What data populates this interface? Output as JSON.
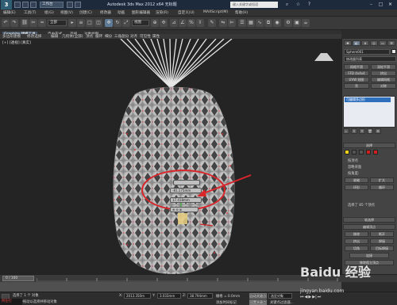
{
  "titlebar": {
    "logo": "3",
    "workspace": "工作台",
    "title": "Autodesk 3ds Max 2012 x64    无标题",
    "search_placeholder": "键入关键字或短语"
  },
  "menu": [
    "编辑(E)",
    "工具(T)",
    "组(G)",
    "视图(V)",
    "创建(C)",
    "修改器",
    "动画",
    "图形编辑器",
    "渲染(R)",
    "自定义(U)",
    "MAXScript(M)",
    "帮助(H)"
  ],
  "toolbar": {
    "filter_select": "全部",
    "view_select": "视图"
  },
  "ribbon": {
    "tabs": [
      "Graphite 建模工具",
      "自由形式",
      "选择",
      "对象绘制"
    ],
    "sub": [
      "多边形建模",
      "修改选择",
      "编辑",
      "几何体(全部)",
      "顶点",
      "循环",
      "细分",
      "三角剖分",
      "对齐",
      "可见性",
      "属性"
    ]
  },
  "viewport": {
    "label": "[+] [透视] [真实]"
  },
  "gizmo": {
    "row1": "",
    "row2": "-81.175mm",
    "row3": "17.418mm"
  },
  "panel": {
    "object_name": "Sphere001",
    "modifier_list": "修改器列表",
    "buttons": [
      "网格平滑",
      "涡轮平滑",
      "FFD 4x4x4",
      "挤出",
      "UVW 贴图",
      "编辑网格",
      "壳",
      "对称"
    ],
    "stack_item": "可编辑多边形",
    "selection_title": "选择",
    "sel_items": [
      "按顶点",
      "忽略背面",
      "按角度:",
      "收缩",
      "扩大",
      "环形",
      "循环"
    ],
    "sel_status": "选择了 85 个顶点",
    "soft_title": "软选择",
    "edit_title": "编辑顶点",
    "edit_items": [
      "移除",
      "断开",
      "挤出",
      "焊接",
      "切角",
      "目标焊接",
      "连接",
      "移除孤立顶点"
    ]
  },
  "timeline": {
    "frame": "0 / 100"
  },
  "status": {
    "line1": "选择了 1 个 对象",
    "line2": "单击并拖动以选择并移动对象",
    "x_label": "X:",
    "x_val": "2013.350m",
    "y_label": "Y:",
    "y_val": "3.033mm",
    "z_label": "Z:",
    "z_val": "38.794mm",
    "grid": "栅格 = 0.0mm",
    "autokey": "自动关键点",
    "selected": "选定对象",
    "setkey": "设置关键点",
    "keyfilter": "关键点过滤器...",
    "add_time": "添加时间标记",
    "in_progress": "所在行"
  },
  "watermark": {
    "main": "Baidu 经验",
    "sub": "jingyan.baidu.com"
  },
  "colors": {
    "accent": "#2e6fbe",
    "annotation": "#d8262b",
    "selected_vertex": "#e8d080"
  }
}
